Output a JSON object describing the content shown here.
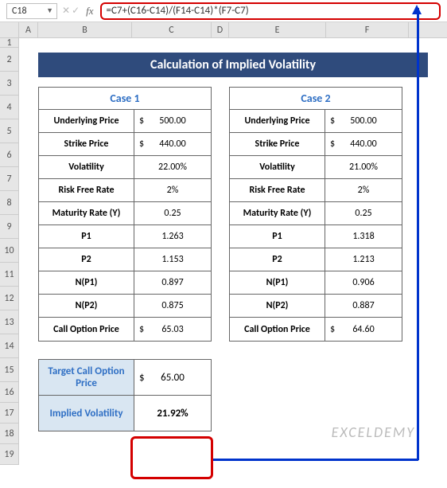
{
  "nameBox": "C18",
  "formula": "=C7+(C16-C14)/(F14-C14)*(F7-C7)",
  "columns": [
    "A",
    "B",
    "C",
    "D",
    "E",
    "F"
  ],
  "rows": [
    "1",
    "2",
    "3",
    "4",
    "5",
    "6",
    "7",
    "8",
    "9",
    "10",
    "11",
    "12",
    "13",
    "14",
    "15",
    "16",
    "17",
    "18",
    "19"
  ],
  "title": "Calculation of Implied Volatility",
  "case1": {
    "header": "Case 1",
    "rows": [
      {
        "label": "Underlying Price",
        "cur": "$",
        "val": "500.00"
      },
      {
        "label": "Strike Price",
        "cur": "$",
        "val": "440.00"
      },
      {
        "label": "Volatility",
        "cur": "",
        "val": "22.00%"
      },
      {
        "label": "Risk Free Rate",
        "cur": "",
        "val": "2%"
      },
      {
        "label": "Maturity Rate (Y)",
        "cur": "",
        "val": "0.25"
      },
      {
        "label": "P1",
        "cur": "",
        "val": "1.263"
      },
      {
        "label": "P2",
        "cur": "",
        "val": "1.153"
      },
      {
        "label": "N(P1)",
        "cur": "",
        "val": "0.897"
      },
      {
        "label": "N(P2)",
        "cur": "",
        "val": "0.875"
      },
      {
        "label": "Call Option Price",
        "cur": "$",
        "val": "65.03"
      }
    ]
  },
  "case2": {
    "header": "Case 2",
    "rows": [
      {
        "label": "Underlying Price",
        "cur": "$",
        "val": "500.00"
      },
      {
        "label": "Strike Price",
        "cur": "$",
        "val": "440.00"
      },
      {
        "label": "Volatility",
        "cur": "",
        "val": "21.00%"
      },
      {
        "label": "Risk Free Rate",
        "cur": "",
        "val": "2%"
      },
      {
        "label": "Maturity Rate (Y)",
        "cur": "",
        "val": "0.25"
      },
      {
        "label": "P1",
        "cur": "",
        "val": "1.318"
      },
      {
        "label": "P2",
        "cur": "",
        "val": "1.213"
      },
      {
        "label": "N(P1)",
        "cur": "",
        "val": "0.906"
      },
      {
        "label": "N(P2)",
        "cur": "",
        "val": "0.887"
      },
      {
        "label": "Call Option Price",
        "cur": "$",
        "val": "64.60"
      }
    ]
  },
  "target": {
    "label": "Target Call Option Price",
    "cur": "$",
    "val": "65.00"
  },
  "result": {
    "label": "Implied Volatility",
    "val": "21.92%"
  },
  "watermark": "EXCELDEMY"
}
